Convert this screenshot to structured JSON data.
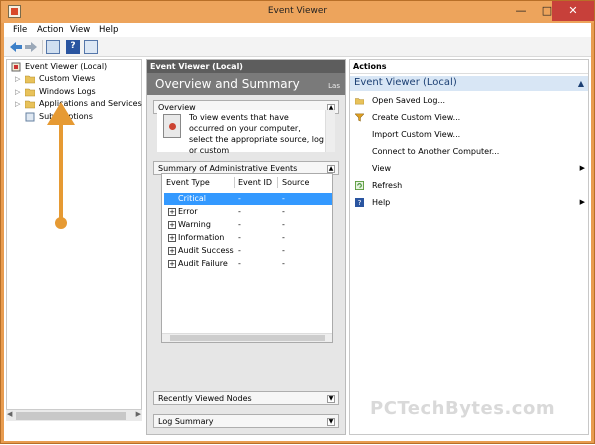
{
  "window": {
    "title": "Event Viewer"
  },
  "colors": {
    "titlebar": "#eda45c",
    "selection": "#3399ff",
    "annotation": "#e69a33",
    "actions_sub": "#d8e6f5"
  },
  "menubar": {
    "items": [
      "File",
      "Action",
      "View",
      "Help"
    ]
  },
  "toolbar": {
    "help_label": "?"
  },
  "tree": {
    "items": [
      {
        "label": "Event Viewer (Local)",
        "icon": "event-viewer-icon"
      },
      {
        "label": "Custom Views",
        "icon": "folder-icon"
      },
      {
        "label": "Windows Logs",
        "icon": "folder-icon"
      },
      {
        "label": "Applications and Services Lo",
        "icon": "folder-icon"
      },
      {
        "label": "Subscriptions",
        "icon": "subscriptions-icon"
      }
    ]
  },
  "middle": {
    "header": "Event Viewer (Local)",
    "banner": "Overview and Summary",
    "banner_right": "Las",
    "overview_label": "Overview",
    "overview_text": "To view events that have occurred on your computer, select the appropriate source, log or custom",
    "summary_label": "Summary of Administrative Events",
    "table": {
      "columns": [
        "Event Type",
        "Event ID",
        "Source"
      ],
      "rows": [
        {
          "type": "Critical",
          "id": "-",
          "source": "-",
          "selected": true
        },
        {
          "type": "Error",
          "id": "-",
          "source": "-"
        },
        {
          "type": "Warning",
          "id": "-",
          "source": "-"
        },
        {
          "type": "Information",
          "id": "-",
          "source": "-"
        },
        {
          "type": "Audit Success",
          "id": "-",
          "source": "-"
        },
        {
          "type": "Audit Failure",
          "id": "-",
          "source": "-"
        }
      ]
    },
    "recent_label": "Recently Viewed Nodes",
    "log_summary_label": "Log Summary"
  },
  "actions": {
    "header": "Actions",
    "sub": "Event Viewer (Local)",
    "items": [
      {
        "label": "Open Saved Log...",
        "icon": "open-log-icon"
      },
      {
        "label": "Create Custom View...",
        "icon": "filter-icon"
      },
      {
        "label": "Import Custom View..."
      },
      {
        "label": "Connect to Another Computer..."
      },
      {
        "label": "View",
        "submenu": true
      },
      {
        "label": "Refresh",
        "icon": "refresh-icon"
      },
      {
        "label": "Help",
        "icon": "help-icon",
        "submenu": true
      }
    ]
  },
  "watermark": "PCTechBytes.com"
}
